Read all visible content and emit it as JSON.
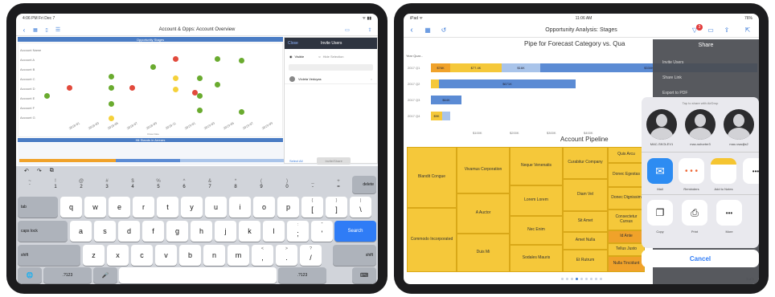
{
  "left_device": {
    "status": {
      "time": "4:06 PM  Fri Dec 7"
    },
    "nav": {
      "title": "Account & Opps: Account Overview"
    },
    "chart": {
      "banner": "Opportunity Stages",
      "x_title": "Close Date",
      "y_labels": [
        "Account Name",
        "Account A",
        "Account B",
        "Account C",
        "Account D",
        "Account E",
        "Account F",
        "Account G"
      ],
      "x_labels": [
        "2018-01",
        "2018-03",
        "2018-05",
        "2018-07",
        "2018-09",
        "2018-11",
        "2019-01",
        "2019-03",
        "2019-05",
        "2019-07",
        "2019-09"
      ]
    },
    "table_banner": "Hit Stands in Arrears",
    "popover": {
      "header_left": "Close",
      "header_title": "Invite Users",
      "option_1": "Visible",
      "option_2": "Hide Selection",
      "selected_user": "Violeta Vedoyas",
      "footer_left": "Select All",
      "footer_button": "Invite/Share"
    },
    "keyboard": {
      "toolbar": [
        "↶",
        "↷",
        "⧉"
      ],
      "number_row": [
        {
          "top": "~",
          "main": "`"
        },
        {
          "top": "!",
          "main": "1"
        },
        {
          "top": "@",
          "main": "2"
        },
        {
          "top": "#",
          "main": "3"
        },
        {
          "top": "$",
          "main": "4"
        },
        {
          "top": "%",
          "main": "5"
        },
        {
          "top": "^",
          "main": "6"
        },
        {
          "top": "&",
          "main": "7"
        },
        {
          "top": "*",
          "main": "8"
        },
        {
          "top": "(",
          "main": "9"
        },
        {
          "top": ")",
          "main": "0"
        },
        {
          "top": "_",
          "main": "-"
        },
        {
          "top": "+",
          "main": "="
        }
      ],
      "delete": "delete",
      "tab": "tab",
      "row1": [
        "q",
        "w",
        "e",
        "r",
        "t",
        "y",
        "u",
        "i",
        "o",
        "p"
      ],
      "row1_extra": [
        {
          "top": "{",
          "main": "["
        },
        {
          "top": "}",
          "main": "]"
        },
        {
          "top": "|",
          "main": "\\"
        }
      ],
      "capslock": "caps lock",
      "row2": [
        "a",
        "s",
        "d",
        "f",
        "g",
        "h",
        "j",
        "k",
        "l"
      ],
      "row2_extra": [
        {
          "top": ":",
          "main": ";"
        },
        {
          "top": "\"",
          "main": "'"
        }
      ],
      "search": "Search",
      "shift": "shift",
      "row3": [
        "z",
        "x",
        "c",
        "v",
        "b",
        "n",
        "m"
      ],
      "row3_extra": [
        {
          "top": "<",
          "main": ","
        },
        {
          "top": ">",
          "main": "."
        },
        {
          "top": "?",
          "main": "/"
        }
      ],
      "globe": "🌐",
      "num_key": ".?123",
      "mic": "🎤",
      "dismiss": "⌨"
    }
  },
  "right_device": {
    "status": {
      "left": "iPad ᯤ",
      "time": "11:06 AM",
      "battery": "76%"
    },
    "nav": {
      "title": "Opportunity Analysis: Stages",
      "badge": "3"
    },
    "chart": {
      "title": "Pipe for Forecast Category vs. Qua",
      "header_label": "Year Quar...",
      "rows": [
        {
          "label": "2017 Q1",
          "value_1": "$76K",
          "value_2": "$77.4K",
          "value_3": "$16K",
          "value_4": "$330K"
        },
        {
          "label": "2017 Q2",
          "value_1": "",
          "value_2": "$671K",
          "value_3": "",
          "value_4": ""
        },
        {
          "label": "2017 Q3",
          "value_1": "$64K",
          "value_2": "",
          "value_3": "",
          "value_4": ""
        },
        {
          "label": "2017 Q4",
          "value_1": "$9K",
          "value_2": "",
          "value_3": "",
          "value_4": ""
        }
      ],
      "x_ticks": [
        "$100K",
        "$200K",
        "$300K",
        "$400K"
      ]
    },
    "treemap": {
      "title": "Account Pipeline",
      "cells": [
        "Blandit Congue",
        "Vivamus Corporation",
        "Neque Venenatis",
        "Curabitur Company",
        "Quis Arcu",
        "Donec Egestas",
        "Lorem Lorem",
        "Diam Vel",
        "Donec Dignissim",
        "A Auctor",
        "Sit Amet",
        "Consectetur Cursus",
        "Commodo Incorporated",
        "Nec Enim",
        "Amet Nulla",
        "Id Ante",
        "Tellus Justo",
        "Duis Mi",
        "Sodales Mauris",
        "Et Rutrum",
        "Nulla Tincidunt"
      ]
    },
    "share": {
      "menu_title": "Share",
      "menu_items": [
        "Invite Users",
        "Share Link",
        "Export to PDF"
      ],
      "airdrop_hint": "Tap to share with AirDrop",
      "people": [
        "MAC-SKOLEV1",
        "mac-sshorter3",
        "mac-vsadjis2"
      ],
      "apps": [
        "Mail",
        "Reminders",
        "Add to Notes",
        "More"
      ],
      "actions": [
        "Copy",
        "Print",
        "More"
      ],
      "cancel": "Cancel"
    },
    "page_counter": "3 of 9"
  }
}
